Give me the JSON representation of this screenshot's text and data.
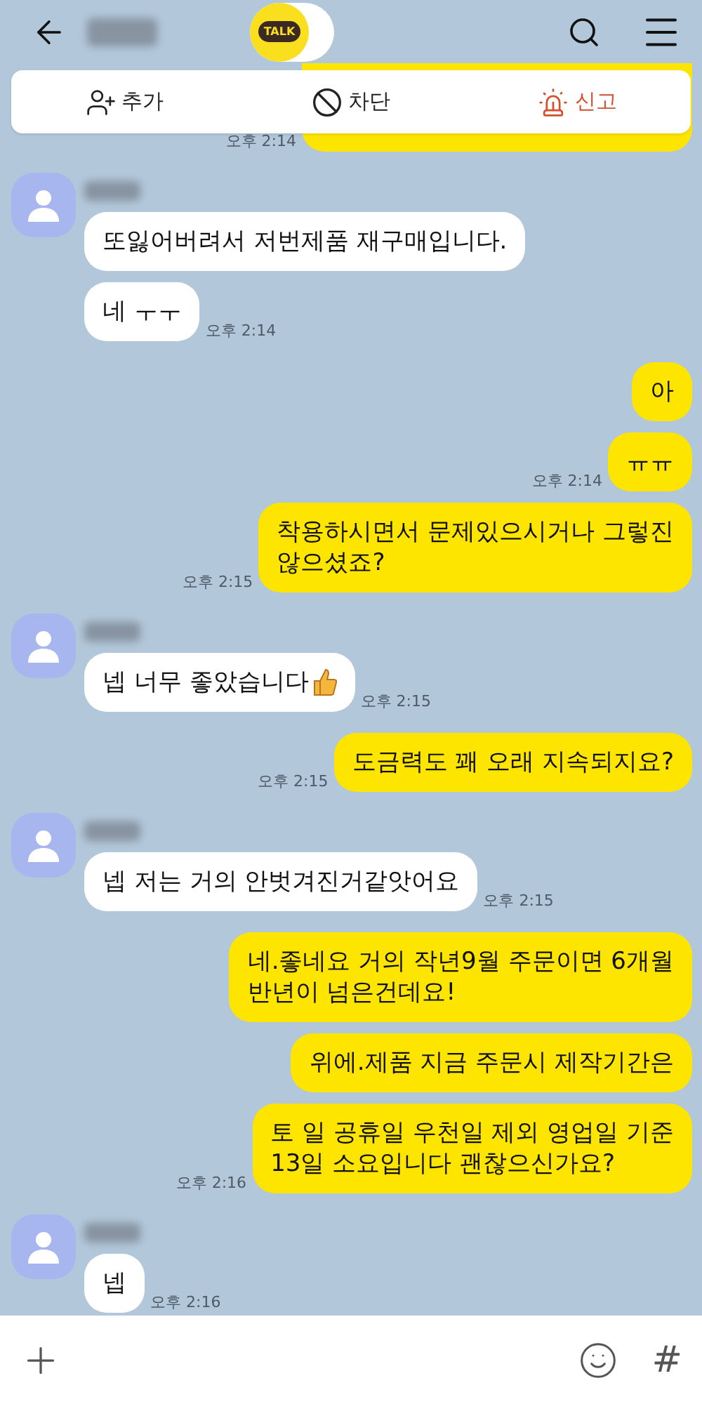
{
  "header": {
    "logo_text": "TALK"
  },
  "action_bar": [
    {
      "label": "추가",
      "kind": "add",
      "danger": false
    },
    {
      "label": "차단",
      "kind": "block",
      "danger": false
    },
    {
      "label": "신고",
      "kind": "report",
      "danger": true
    }
  ],
  "top_fragment": {
    "time": "오후 2:14"
  },
  "messages": [
    {
      "kind": "in",
      "avatar": true,
      "text": "또잃어버려서 저번제품 재구매입니다."
    },
    {
      "kind": "in",
      "avatar": false,
      "text": "네 ㅜㅜ",
      "time": "오후 2:14"
    },
    {
      "kind": "out",
      "text": "아"
    },
    {
      "kind": "out",
      "text": "ㅠㅠ",
      "time": "오후 2:14"
    },
    {
      "kind": "out",
      "text": "착용하시면서 문제있으시거나 그렇진\n않으셨죠?",
      "time": "오후 2:15"
    },
    {
      "kind": "in",
      "avatar": true,
      "text": "넵 너무 좋았습니다",
      "trailing_icon": true,
      "time": "오후 2:15"
    },
    {
      "kind": "out",
      "text": "도금력도 꽤 오래 지속되지요?",
      "time": "오후 2:15"
    },
    {
      "kind": "in",
      "avatar": true,
      "text": "넵 저는 거의 안벗겨진거같앗어요",
      "time": "오후 2:15"
    },
    {
      "kind": "out",
      "text": "네.좋네요 거의 작년9월 주문이면 6개월\n반년이 넘은건데요!"
    },
    {
      "kind": "out",
      "text": "위에.제품 지금 주문시 제작기간은"
    },
    {
      "kind": "out",
      "text": "토 일 공휴일 우천일 제외 영업일 기준\n13일 소요입니다 괜찮으신가요?",
      "time": "오후 2:16"
    },
    {
      "kind": "in",
      "avatar": true,
      "text": "넵",
      "time": "오후 2:16"
    }
  ],
  "input_bar": {
    "hash_key": "#"
  }
}
